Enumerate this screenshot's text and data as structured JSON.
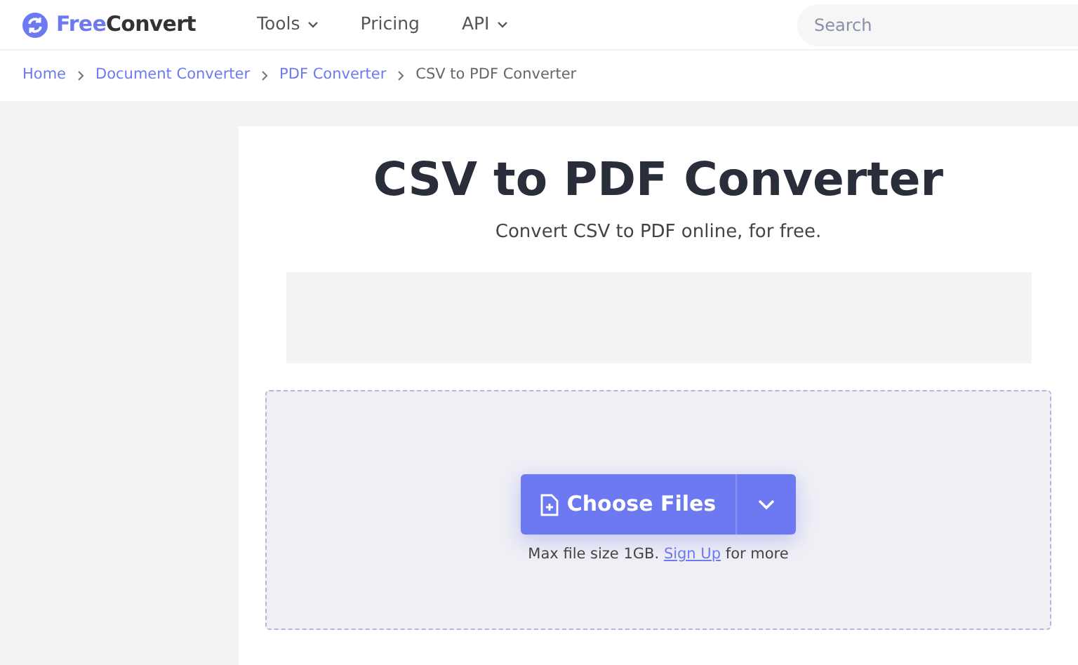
{
  "header": {
    "brand": {
      "first": "Free",
      "second": "Convert"
    },
    "nav": [
      {
        "label": "Tools",
        "dropdown": true
      },
      {
        "label": "Pricing",
        "dropdown": false
      },
      {
        "label": "API",
        "dropdown": true
      }
    ],
    "search": {
      "placeholder": "Search"
    }
  },
  "breadcrumbs": [
    {
      "label": "Home",
      "current": false
    },
    {
      "label": "Document Converter",
      "current": false
    },
    {
      "label": "PDF Converter",
      "current": false
    },
    {
      "label": "CSV to PDF Converter",
      "current": true
    }
  ],
  "title": "CSV to PDF Converter",
  "subtitle": "Convert CSV to PDF online, for free.",
  "upload": {
    "button": "Choose Files",
    "note_before": "Max file size 1GB.",
    "link": "Sign Up",
    "note_after": "for more"
  }
}
